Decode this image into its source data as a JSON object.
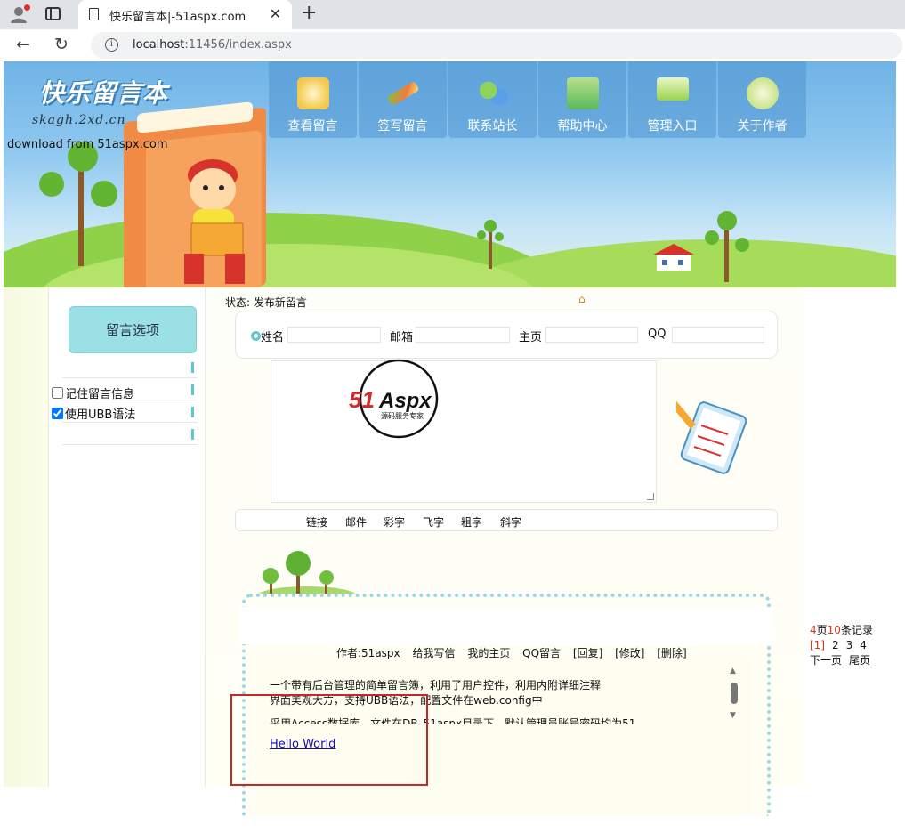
{
  "browser": {
    "tab_title": "快乐留言本|-51aspx.com",
    "url_host": "localhost",
    "url_rest": ":11456/index.aspx"
  },
  "header": {
    "logo_text": "快乐留言本",
    "logo_domain": "skagh.2xd.cn",
    "download_note": "download from 51aspx.com",
    "nav": [
      "查看留言",
      "签写留言",
      "联系站长",
      "帮助中心",
      "管理入口",
      "关于作者"
    ]
  },
  "sidebar": {
    "options_title": "留言选项",
    "remember_label": "记住留言信息",
    "remember_checked": false,
    "ubb_label": "使用UBB语法",
    "ubb_checked": true
  },
  "form": {
    "status": "状态: 发布新留言",
    "name_label": "姓名",
    "email_label": "邮箱",
    "homepage_label": "主页",
    "qq_label": "QQ",
    "name_value": "",
    "email_value": "",
    "homepage_value": "",
    "qq_value": "",
    "logo_text": "51Aspx",
    "logo_sub": "源码服务专家"
  },
  "toolbar": [
    "链接",
    "邮件",
    "彩字",
    "飞字",
    "粗字",
    "斜字"
  ],
  "message": {
    "author": "作者:51aspx",
    "actions": [
      "给我写信",
      "我的主页",
      "QQ留言",
      "[回复]",
      "[修改]",
      "[删除]"
    ],
    "line1": "一个带有后台管理的简单留言簿，利用了用户控件，利用内附详细注释",
    "line2": "界面美观大方，支持UBB语法，配置文件在web.config中",
    "line3": "采用Access数据库，文件在DB_51aspx目录下，默认管理员账号密码均为51",
    "link": "Hello World"
  },
  "pager": {
    "pages": "4",
    "pages_suffix": "页",
    "records": "10",
    "records_suffix": "条记录",
    "current": "[1]",
    "others": [
      "2",
      "3",
      "4"
    ],
    "next": "下一页",
    "last": "尾页"
  },
  "colors": {
    "nav_bg": "#5096d2",
    "accent": "#9be0e4",
    "highlight": "#c62828"
  }
}
